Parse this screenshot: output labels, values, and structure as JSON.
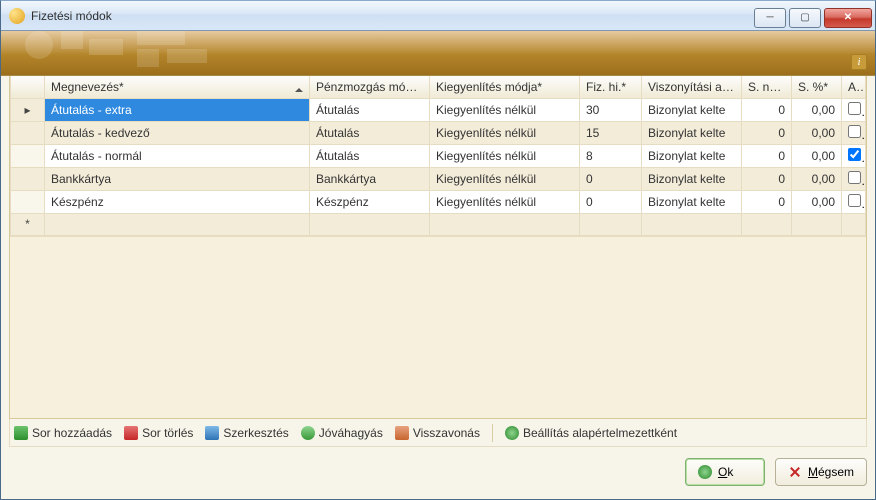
{
  "window": {
    "title": "Fizetési módok"
  },
  "banner": {
    "info_tooltip": "i"
  },
  "columns": {
    "name": "Megnevezés*",
    "movement": "Pénzmozgás módja*",
    "settlement": "Kiegyenlítés módja*",
    "deadline": "Fiz. hi.*",
    "basis": "Viszonyítási alap*",
    "snap": "S. nap*",
    "spct": "S. %*",
    "a": "A*"
  },
  "rows": [
    {
      "name": "Átutalás - extra",
      "movement": "Átutalás",
      "settlement": "Kiegyenlítés nélkül",
      "deadline": "30",
      "basis": "Bizonylat kelte",
      "snap": "0",
      "spct": "0,00",
      "a": false,
      "selected": true,
      "indicator": "▸"
    },
    {
      "name": "Átutalás - kedvező",
      "movement": "Átutalás",
      "settlement": "Kiegyenlítés nélkül",
      "deadline": "15",
      "basis": "Bizonylat kelte",
      "snap": "0",
      "spct": "0,00",
      "a": false
    },
    {
      "name": "Átutalás - normál",
      "movement": "Átutalás",
      "settlement": "Kiegyenlítés nélkül",
      "deadline": "8",
      "basis": "Bizonylat kelte",
      "snap": "0",
      "spct": "0,00",
      "a": true
    },
    {
      "name": "Bankkártya",
      "movement": "Bankkártya",
      "settlement": "Kiegyenlítés nélkül",
      "deadline": "0",
      "basis": "Bizonylat kelte",
      "snap": "0",
      "spct": "0,00",
      "a": false
    },
    {
      "name": "Készpénz",
      "movement": "Készpénz",
      "settlement": "Kiegyenlítés nélkül",
      "deadline": "0",
      "basis": "Bizonylat kelte",
      "snap": "0",
      "spct": "0,00",
      "a": false
    }
  ],
  "new_row_indicator": "*",
  "toolbar": {
    "add": "Sor hozzáadás",
    "delete": "Sor törlés",
    "edit": "Szerkesztés",
    "approve": "Jóváhagyás",
    "undo": "Visszavonás",
    "default": "Beállítás alapértelmezettként"
  },
  "footer": {
    "ok": "Ok",
    "cancel": "Mégsem"
  }
}
